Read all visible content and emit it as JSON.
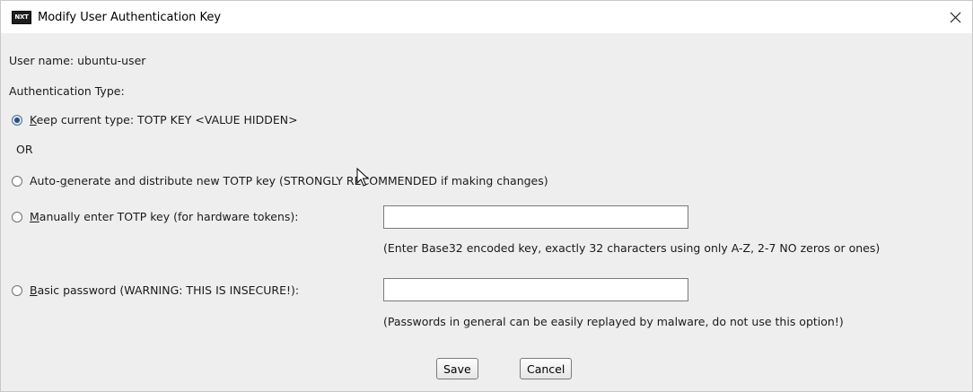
{
  "window": {
    "app_icon_text": "NXT",
    "title": "Modify User Authentication Key",
    "close_glyph": "✕"
  },
  "user_line": "User name: ubuntu-user",
  "auth_type_label": "Authentication Type:",
  "options": {
    "keep": {
      "mnemonic": "K",
      "rest": "eep current type: TOTP KEY <VALUE HIDDEN>",
      "selected": true
    },
    "or_text": "OR",
    "auto": {
      "pre": "Auto-",
      "mnemonic": "g",
      "rest": "enerate and distribute new TOTP key (STRONGLY RECOMMENDED if making changes)",
      "selected": false
    },
    "manual": {
      "mnemonic": "M",
      "rest": "anually enter TOTP key (for hardware tokens):",
      "selected": false,
      "input_value": "",
      "hint": "(Enter Base32 encoded key, exactly 32 characters using only A-Z, 2-7  NO zeros or ones)"
    },
    "basic": {
      "mnemonic": "B",
      "rest": "asic password (WARNING: THIS IS INSECURE!):",
      "selected": false,
      "input_value": "",
      "hint": "(Passwords in general can be easily replayed by malware, do not use this option!)"
    }
  },
  "buttons": {
    "save": "Save",
    "cancel": "Cancel"
  },
  "icons": {
    "app": "nxt-app-icon",
    "close": "close-icon",
    "cursor": "mouse-pointer-icon"
  }
}
